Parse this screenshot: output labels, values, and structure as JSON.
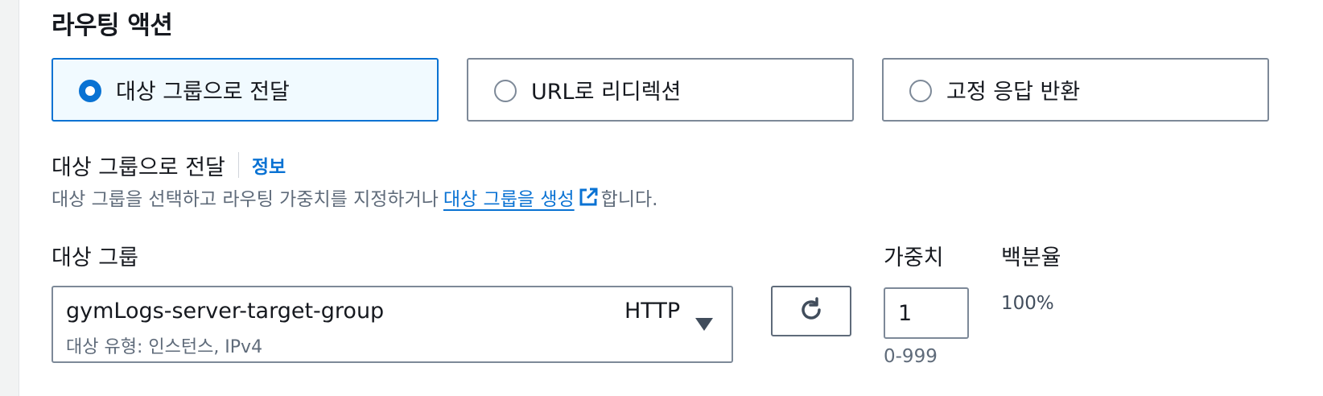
{
  "routing_action": {
    "title": "라우팅 액션",
    "options": [
      {
        "label": "대상 그룹으로 전달",
        "selected": true
      },
      {
        "label": "URL로 리디렉션",
        "selected": false
      },
      {
        "label": "고정 응답 반환",
        "selected": false
      }
    ]
  },
  "forward": {
    "label": "대상 그룹으로 전달",
    "info_link": "정보",
    "description_prefix": "대상 그룹을 선택하고 라우팅 가중치를 지정하거나",
    "description_link": "대상 그룹을 생성",
    "description_suffix": "합니다."
  },
  "columns": {
    "target_group": "대상 그룹",
    "weight": "가중치",
    "percentage": "백분율"
  },
  "target_group_select": {
    "value": "gymLogs-server-target-group",
    "protocol": "HTTP",
    "subtext": "대상 유형: 인스턴스, IPv4"
  },
  "weight_field": {
    "value": "1",
    "hint": "0-999"
  },
  "percentage_value": "100%",
  "icons": {
    "external_link": "external-link-icon",
    "refresh": "refresh-icon",
    "dropdown": "caret-down-icon"
  },
  "colors": {
    "accent": "#0972d3",
    "selected_bg": "#f1faff",
    "border": "#7d8998",
    "secondary_text": "#5f6b7a"
  }
}
